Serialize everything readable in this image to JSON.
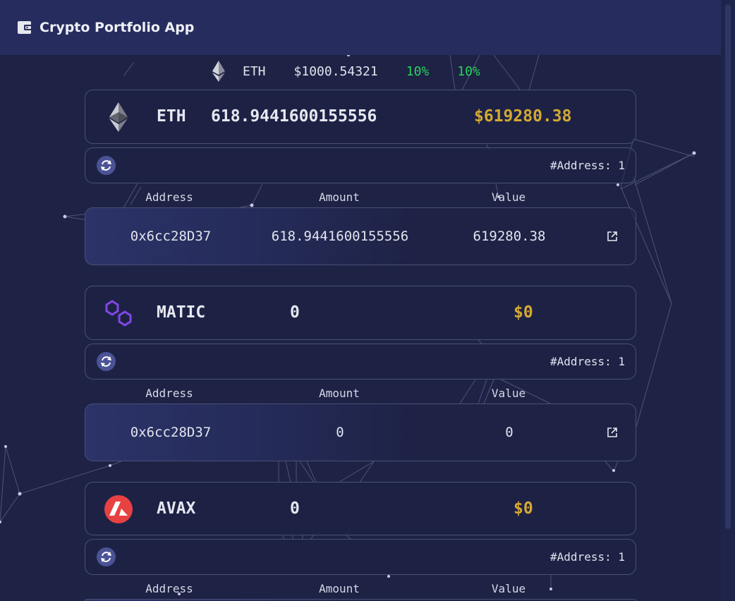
{
  "app": {
    "title": "Crypto Portfolio App"
  },
  "ticker": {
    "symbol": "ETH",
    "price": "$1000.54321",
    "change_1": "10%",
    "change_2": "10%"
  },
  "table_headers": {
    "address": "Address",
    "amount": "Amount",
    "value": "Value"
  },
  "coins": [
    {
      "symbol": "ETH",
      "amount": "618.9441600155556",
      "value": "$619280.38",
      "address_count": "#Address: 1",
      "rows": [
        {
          "address": "0x6cc28D37",
          "amount": "618.9441600155556",
          "value": "619280.38"
        }
      ]
    },
    {
      "symbol": "MATIC",
      "amount": "0",
      "value": "$0",
      "address_count": "#Address: 1",
      "rows": [
        {
          "address": "0x6cc28D37",
          "amount": "0",
          "value": "0"
        }
      ]
    },
    {
      "symbol": "AVAX",
      "amount": "0",
      "value": "$0",
      "address_count": "#Address: 1",
      "rows": []
    }
  ],
  "colors": {
    "value_gold": "#d4a934",
    "change_green": "#25d35a",
    "avax_red": "#e84142",
    "matic_purple": "#8247e5"
  }
}
